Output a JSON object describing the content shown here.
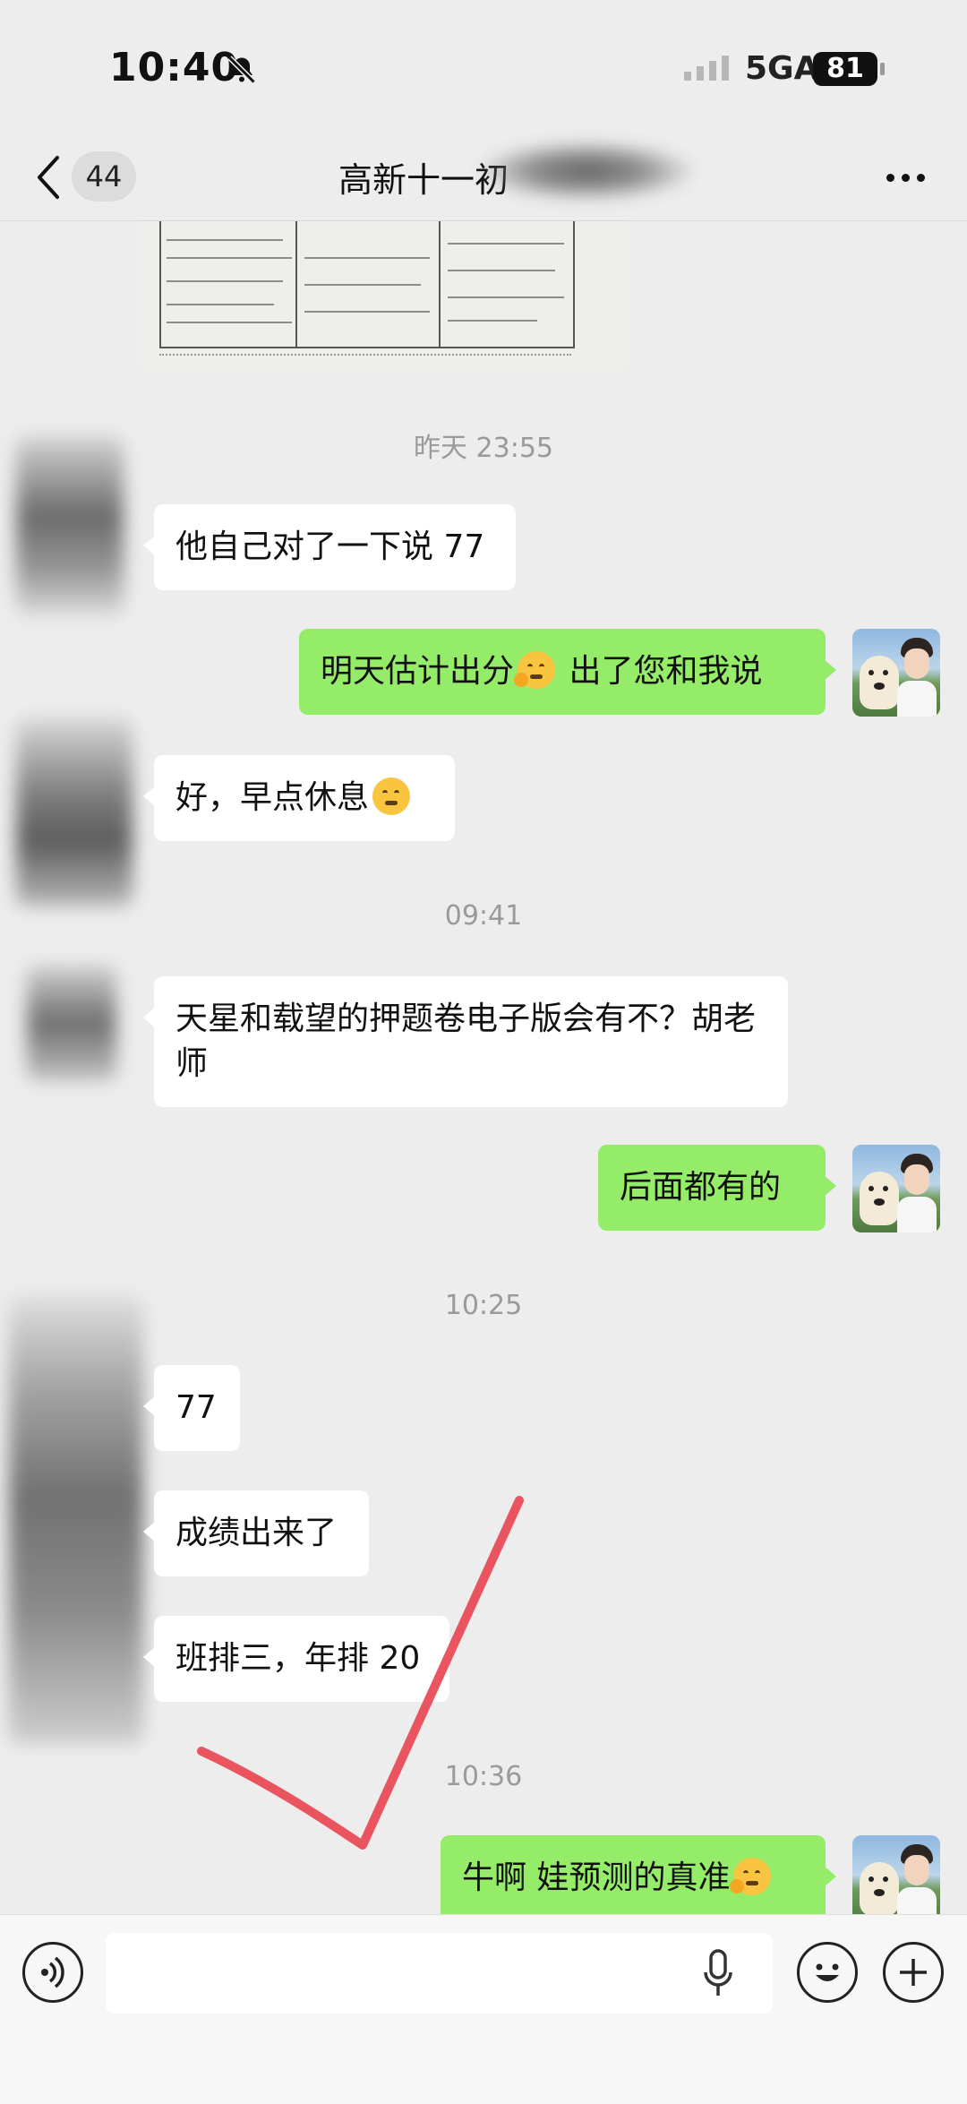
{
  "status_bar": {
    "time": "10:40",
    "network": "5GA",
    "battery": "81"
  },
  "nav": {
    "back_label": "<",
    "unread_count": "44",
    "title": "高新十一初"
  },
  "messages": {
    "ts1": "昨天 23:55",
    "m1": "他自己对了一下说 77",
    "m2_a": "明天估计出分",
    "m2_b": " 出了您和我说",
    "m3": "好，早点休息",
    "ts2": "09:41",
    "m4": "天星和载望的押题卷电子版会有不？胡老师",
    "m5": "后面都有的",
    "ts3": "10:25",
    "m6": "77",
    "m7": "成绩出来了",
    "m8": "班排三，年排 20",
    "ts4": "10:36",
    "m9": "牛啊 娃预测的真准"
  },
  "input": {
    "placeholder": ""
  },
  "colors": {
    "outgoing_bubble": "#95ec69",
    "incoming_bubble": "#ffffff",
    "background": "#ededed",
    "check_mark": "#e8434f"
  }
}
